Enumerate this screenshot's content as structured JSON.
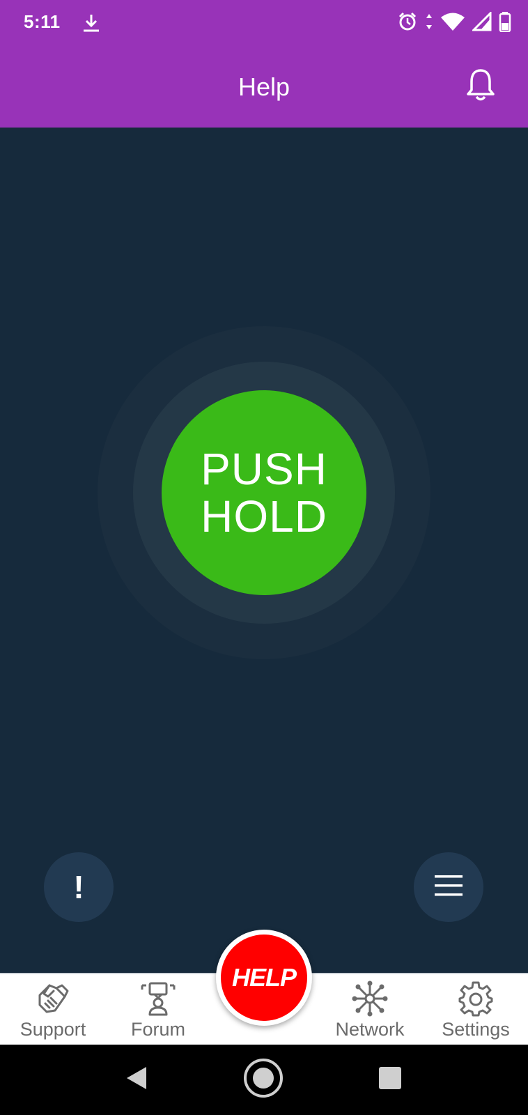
{
  "status_bar": {
    "time": "5:11",
    "icons": [
      "download-icon",
      "alarm-icon",
      "data-arrows-icon",
      "wifi-icon",
      "signal-icon",
      "battery-icon"
    ]
  },
  "app_bar": {
    "title": "Help",
    "action_icon": "bell-icon"
  },
  "main": {
    "push_button": {
      "line1": "PUSH",
      "line2": "HOLD",
      "color": "#3aba18"
    },
    "left_button": {
      "icon": "exclamation-icon",
      "glyph": "!"
    },
    "right_button": {
      "icon": "menu-icon"
    }
  },
  "bottom_nav": {
    "items": [
      {
        "label": "Support",
        "icon": "handshake-icon"
      },
      {
        "label": "Forum",
        "icon": "forum-icon"
      },
      {
        "label": "Network",
        "icon": "network-icon"
      },
      {
        "label": "Settings",
        "icon": "gear-icon"
      }
    ],
    "center_button": {
      "label": "HELP",
      "color": "#ff0000"
    }
  },
  "colors": {
    "header": "#9833b8",
    "background": "#162a3c",
    "accent_green": "#3aba18",
    "help_red": "#ff0000"
  }
}
